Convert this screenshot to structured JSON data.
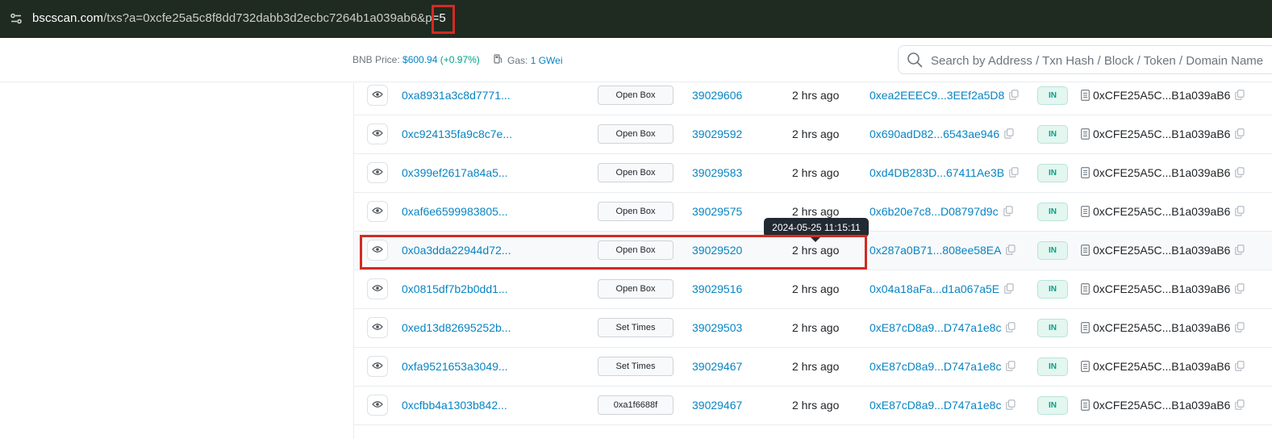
{
  "browser": {
    "url_host": "bscscan.com",
    "url_path": "/txs?a=0xcfe25a5c8f8dd732dabb3d2ecbc7264b1a039ab6&p",
    "url_tail": "=5",
    "url_icon": "site-settings-icon"
  },
  "header": {
    "bnb_price_label": "BNB Price:",
    "bnb_price_value": "$600.94",
    "bnb_price_change": "(+0.97%)",
    "gas_label": "Gas:",
    "gas_value": "1 GWei",
    "search_placeholder": "Search by Address / Txn Hash / Block / Token / Domain Name"
  },
  "tooltip": "2024-05-25 11:15:11",
  "transactions": [
    {
      "hash": "0xa8931a3c8d7771...",
      "method": "Open Box",
      "block": "39029606",
      "age": "2 hrs ago",
      "from": "0xea2EEEC9...3EEf2a5D8",
      "direction": "IN",
      "to": "0xCFE25A5C...B1a039aB6"
    },
    {
      "hash": "0xc924135fa9c8c7e...",
      "method": "Open Box",
      "block": "39029592",
      "age": "2 hrs ago",
      "from": "0x690adD82...6543ae946",
      "direction": "IN",
      "to": "0xCFE25A5C...B1a039aB6"
    },
    {
      "hash": "0x399ef2617a84a5...",
      "method": "Open Box",
      "block": "39029583",
      "age": "2 hrs ago",
      "from": "0xd4DB283D...67411Ae3B",
      "direction": "IN",
      "to": "0xCFE25A5C...B1a039aB6"
    },
    {
      "hash": "0xaf6e6599983805...",
      "method": "Open Box",
      "block": "39029575",
      "age": "2 hrs ago",
      "from": "0x6b20e7c8...D08797d9c",
      "direction": "IN",
      "to": "0xCFE25A5C...B1a039aB6"
    },
    {
      "hash": "0x0a3dda22944d72...",
      "method": "Open Box",
      "block": "39029520",
      "age": "2 hrs ago",
      "from": "0x287a0B71...808ee58EA",
      "direction": "IN",
      "to": "0xCFE25A5C...B1a039aB6"
    },
    {
      "hash": "0x0815df7b2b0dd1...",
      "method": "Open Box",
      "block": "39029516",
      "age": "2 hrs ago",
      "from": "0x04a18aFa...d1a067a5E",
      "direction": "IN",
      "to": "0xCFE25A5C...B1a039aB6"
    },
    {
      "hash": "0xed13d82695252b...",
      "method": "Set Times",
      "block": "39029503",
      "age": "2 hrs ago",
      "from": "0xE87cD8a9...D747a1e8c",
      "direction": "IN",
      "to": "0xCFE25A5C...B1a039aB6"
    },
    {
      "hash": "0xfa9521653a3049...",
      "method": "Set Times",
      "block": "39029467",
      "age": "2 hrs ago",
      "from": "0xE87cD8a9...D747a1e8c",
      "direction": "IN",
      "to": "0xCFE25A5C...B1a039aB6"
    },
    {
      "hash": "0xcfbb4a1303b842...",
      "method": "0xa1f6688f",
      "block": "39029467",
      "age": "2 hrs ago",
      "from": "0xE87cD8a9...D747a1e8c",
      "direction": "IN",
      "to": "0xCFE25A5C...B1a039aB6"
    }
  ]
}
